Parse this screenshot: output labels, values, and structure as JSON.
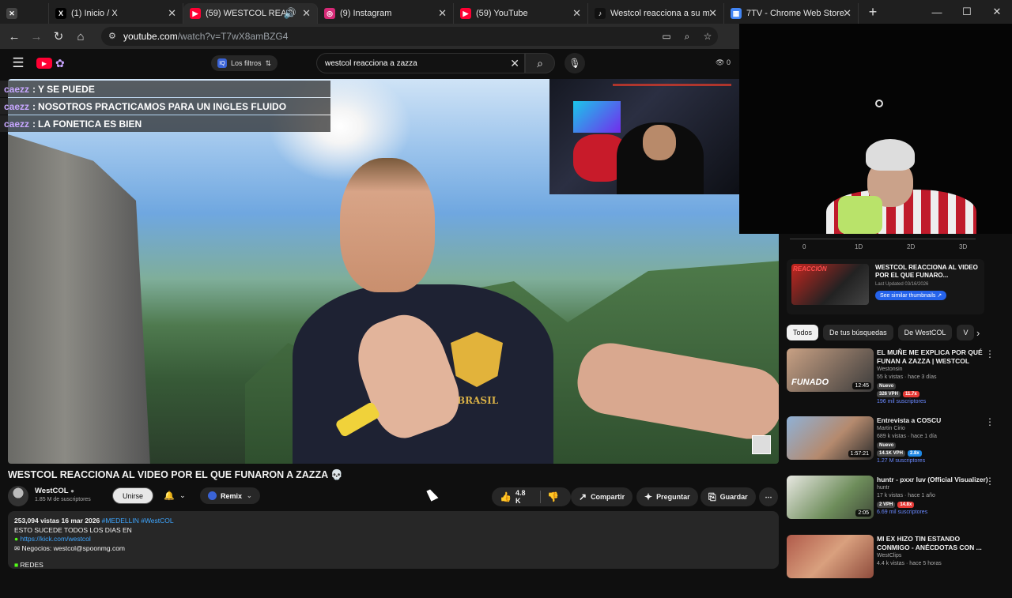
{
  "tabs": [
    {
      "label": "",
      "icon": "muted-tab-icon",
      "color": "#2b2b2b"
    },
    {
      "label": "(1) Inicio / X",
      "icon": "x-logo-icon",
      "color": "#000000"
    },
    {
      "label": "(59) WESTCOL REACCI",
      "icon": "youtube-icon",
      "color": "#ff0033",
      "active": true
    },
    {
      "label": "(9) Instagram",
      "icon": "instagram-icon",
      "color": "#d62976"
    },
    {
      "label": "(59) YouTube",
      "icon": "youtube-icon",
      "color": "#ff0033"
    },
    {
      "label": "Westcol reacciona a su m",
      "icon": "tiktok-icon",
      "color": "#111111"
    },
    {
      "label": "7TV - Chrome Web Store",
      "icon": "webstore-icon",
      "color": "#4285f4"
    }
  ],
  "address": {
    "domain": "youtube.com",
    "path": "/watch?v=T7wX8amBZG4"
  },
  "header": {
    "filters_label": "Los filtros",
    "search_value": "westcol reacciona a zazza",
    "view_count": "0"
  },
  "chat": [
    {
      "user": "caezz",
      "text": "Y SE PUEDE"
    },
    {
      "user": "caezz",
      "text": "NOSOTROS PRACTICAMOS PARA UN INGLES FLUIDO"
    },
    {
      "user": "caezz",
      "text": "LA FONETICA ES BIEN"
    }
  ],
  "video": {
    "shirt_text": "BRASIL",
    "title": "WESTCOL REACCIONA AL VIDEO POR EL QUE FUNARON A ZAZZA 💀",
    "channel": "WestCOL",
    "subscribers": "1.85 M de suscriptores",
    "join_label": "Unirse",
    "remix_label": "Remix",
    "likes": "4.8 K",
    "share_label": "Compartir",
    "ask_label": "Preguntar",
    "save_label": "Guardar"
  },
  "description": {
    "views_date": "253,094 vistas  16 mar 2026",
    "hashtags": "#MEDELLIN #WestCOL",
    "line1": "ESTO SUCEDE TODOS LOS DIAS EN",
    "link": "https://kick.com/westcol",
    "business": "Negocios: westcol@spoonmg.com",
    "redes": "REDES"
  },
  "sidebar": {
    "axis": [
      "0",
      "1D",
      "2D",
      "3D"
    ],
    "axis_top": "0",
    "card": {
      "thumb_text": "REACCIÓN",
      "title": "WESTCOL REACCIONA AL VIDEO POR EL QUE FUNARO...",
      "updated": "Last Updated 03/16/2026",
      "button": "See similar thumbnails ↗"
    },
    "chips": [
      "Todos",
      "De tus búsquedas",
      "De WestCOL",
      "V"
    ],
    "videos": [
      {
        "title": "EL MUÑE ME EXPLICA POR QUÉ FUNAN A ZAZZA | WESTCOL",
        "channel": "Westonsin",
        "meta": "55 k vistas · hace 3 días",
        "duration": "12:45",
        "thumb_text": "FUNADO",
        "badge": "Nuevo",
        "vph": "326 VPH",
        "ratio": "11.7x",
        "ratio_color": "#e53935",
        "subs": "196 mil suscriptores",
        "thumb_color": "#c9a184"
      },
      {
        "title": "Entrevista a COSCU",
        "channel": "Martin Cirio",
        "meta": "689 k vistas · hace 1 día",
        "duration": "1:57:21",
        "thumb_text": "",
        "badge": "Nuevo",
        "vph": "14.1K VPH",
        "ratio": "2.8x",
        "ratio_color": "#1e88e5",
        "subs": "1.27 M suscriptores",
        "thumb_color": "#8fb1d6"
      },
      {
        "title": "huntr - pxxr luv (Official Visualizer)",
        "channel": "huntr",
        "meta": "17 k vistas · hace 1 año",
        "duration": "2:05",
        "thumb_text": "",
        "badge": "",
        "vph": "2 VPH",
        "ratio": "14.8x",
        "ratio_color": "#e53935",
        "subs": "6.69 mil suscriptores",
        "thumb_color": "#d9d9d2"
      },
      {
        "title": "MI EX HIZO TIN ESTANDO CONMIGO - ANÉCDOTAS CON ...",
        "channel": "WestClips",
        "meta": "4.4 k vistas · hace 5 horas",
        "duration": "",
        "thumb_text": "",
        "badge": "",
        "vph": "",
        "ratio": "",
        "ratio_color": "#e53935",
        "subs": "",
        "thumb_color": "#b05a4a"
      }
    ]
  }
}
